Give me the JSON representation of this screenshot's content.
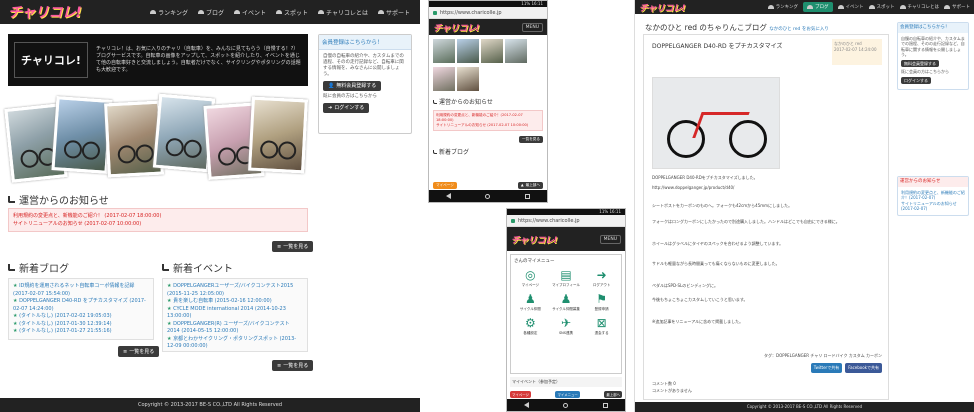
{
  "desktop": {
    "logo": "チャリコレ!",
    "nav": [
      {
        "label": "ランキング",
        "icon": "bicycle-icon"
      },
      {
        "label": "ブログ",
        "icon": "bicycle-icon"
      },
      {
        "label": "イベント",
        "icon": "bicycle-icon"
      },
      {
        "label": "スポット",
        "icon": "bicycle-icon"
      },
      {
        "label": "チャリコレとは",
        "icon": "bicycle-icon"
      },
      {
        "label": "サポート",
        "icon": "bicycle-icon"
      }
    ],
    "hero": {
      "logo": "チャリコレ!",
      "text": "チャリコレ！は、お気に入りのチャリ（自転車）を、みんなに見てもらう（自慢する！?）ブログサービスです。自転車の画像をアップして、スポットを紹介したり、イベントを通じて他の自転車好きと交流しましょう。自転者だけでなく、サイクリングやポタリングの話題も大歓迎です。"
    },
    "member": {
      "title": "会員登録はこちらから！",
      "body": "自慢の自転車の紹介や、カスタムまでの過程、そのの走行記録など、自転車に関する情報を、みなさんに公開しましょう。",
      "register_btn": "無料会員登録する",
      "login_note": "既に会員の方はこちらから",
      "login_btn": "ログインする"
    },
    "notices": {
      "title": "運営からのお知らせ",
      "items": [
        "利用規約の変更点と、新機能のご紹介！ (2017-02-07 18:00:00)",
        "サイトリニューアルのお知らせ (2017-02-07 10:00:00)"
      ],
      "more": "一覧を見る"
    },
    "blog": {
      "title": "新着ブログ",
      "items": [
        "ID規約を運用されるネット自転車コーポ情報を記録 (2017-02-07 15:54:00)",
        "DOPPELGANGER D40-RD をプチカスタマイズ (2017-02-07 14:24:00)",
        "(タイトルなし) (2017-02-02 19:05:03)",
        "(タイトルなし) (2017-01-30 12:39:14)",
        "(タイトルなし) (2017-01-27 21:55:16)"
      ],
      "more": "一覧を見る"
    },
    "events": {
      "title": "新着イベント",
      "items": [
        "DOPPELGANGERユーザーズ/バイクコンテスト2015 (2015-11-25 12:05:00)",
        "貴を楽しむ自転車 (2015-02-16 12:00:00)",
        "CYCLE MODE international 2014 (2014-10-23 13:00:00)",
        "DOPPELGANGER(R) ユーザーズ/バイクコンテスト 2014 (2014-05-15 12:00:00)",
        "京都とわかサイクリング・ポタリングスポット (2013-12-09 00:00:00)"
      ],
      "more": "一覧を見る"
    },
    "footer": "Copyright © 2013-2017 BE-S CO.,LTD All Rights Reserved"
  },
  "phone1": {
    "status": "11%  16:11",
    "url": "https://www.charicolle.jp",
    "menu": "MENU",
    "notice_title": "運営からのお知らせ",
    "notice_items": [
      "利用規約の変更点と、新機能のご紹介！(2017-02-07 18:00:00)",
      "サイトリニューアルのお知らせ (2017-02-07 10:00:00)"
    ],
    "more": "一覧を見る",
    "blog_title": "新着ブログ",
    "bottom_left": "マイページ",
    "bottom_right": "最上部へ"
  },
  "phone2": {
    "status": "11%  16:11",
    "url": "https://www.charicolle.jp",
    "menu": "MENU",
    "panel_title": "さんのマイメニュー",
    "tiles": [
      {
        "label": "マイページ",
        "icon": "bicycle-icon"
      },
      {
        "label": "マイプロフィール",
        "icon": "profile-icon"
      },
      {
        "label": "ログアウト",
        "icon": "logout-icon"
      },
      {
        "label": "サイクル仲間",
        "icon": "group-icon"
      },
      {
        "label": "サイクル仲間募集",
        "icon": "group-icon"
      },
      {
        "label": "登録申請",
        "icon": "flag-icon"
      },
      {
        "label": "各種設定",
        "icon": "gear-icon"
      },
      {
        "label": "SNS連携",
        "icon": "bird-icon"
      },
      {
        "label": "退会する",
        "icon": "close-icon"
      }
    ],
    "events_label": "マイイベント（参加予定）",
    "bottom_left": "マイページ",
    "bottom_mid": "マイメニュー",
    "bottom_right": "最上部へ"
  },
  "blogpage": {
    "logo": "チャリコレ!",
    "nav": [
      "ランキング",
      "ブログ",
      "イベント",
      "スポット",
      "チャリコレとは",
      "サポート"
    ],
    "title": "なかのひと red のちゃりんこブログ",
    "title_sub": "なかのひと red をお気に入り",
    "post_title": "DOPPELGANGER D40-RD をプチカスタマイズ",
    "meta_author": "なかのひと red",
    "meta_date": "2017-02-07 14:24:00",
    "paragraphs": [
      "DOPPELGANGER D40-RDをプチカスタマイズしました。",
      "http://www.doppelganger.jp/product/d40/",
      "シートポストをカーボンのものへ。フォークも42cmから45mmにしました。",
      "フォークはロングカーボンにしたかったので別途購入しました。ハンドルはどこでも自由にできる様に。",
      "ホイールはグラベルにタイヤのスペックを合わせるよう調整しています。",
      "サドルも軽量ながら長時間乗っても痛くならないものに変更しました。",
      "ペダルはSPD-SLのビンディングに。",
      "今後もちょこちょこカスタムしていこうと思います。",
      "※追加記事をリニューアルに含めて掲載しました。"
    ],
    "tags": "タグ：DOPPELGANGER  チャリ  ロードバイク  カスタム  カーボン",
    "share_twitter": "Twitterで共有",
    "share_facebook": "Facebookで共有",
    "comments": "コメント数 0",
    "comment_note": "コメントがありません",
    "member_title": "会員登録はこちらから！",
    "member_body": "自慢の自転車の紹介や、カスタムまでの過程、そのの走行記録など、自転車に関する情報を公開しましょう。",
    "register_btn": "無料会員登録する",
    "login_note": "既に会員の方はこちらから",
    "login_btn": "ログインする",
    "notice_title": "運営からのお知らせ",
    "notice_items": [
      "利用規約の変更点と、新機能のご紹介！(2017-02-07)",
      "サイトリニューアルのお知らせ (2017-02-07)"
    ],
    "footer": "Copyright © 2013-2017 BE-S CO.,LTD All Rights Reserved"
  }
}
